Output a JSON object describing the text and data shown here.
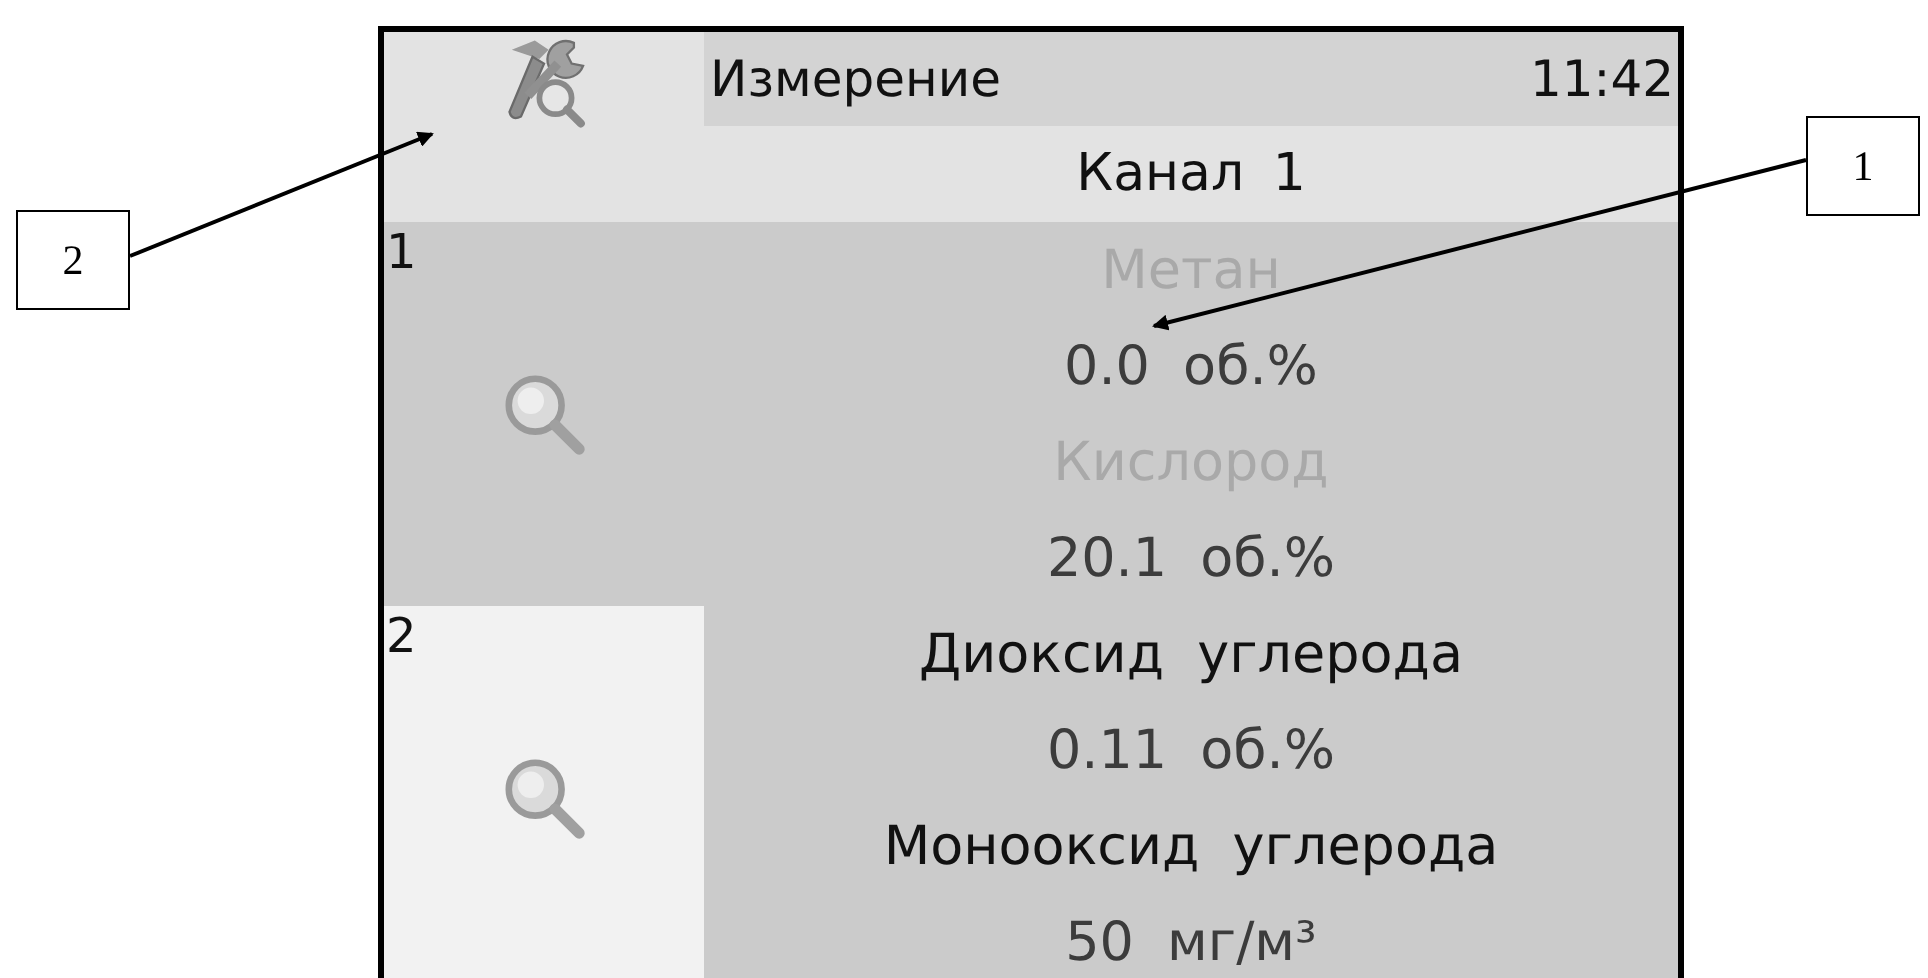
{
  "title": "Измерение",
  "time": "11:42",
  "channel": "Канал 1",
  "sensors": [
    {
      "number": "1",
      "selected": true,
      "gases": [
        {
          "name": "Метан",
          "value": "0.0 об.%",
          "active": false
        },
        {
          "name": "Кислород",
          "value": "20.1 об.%",
          "active": false
        }
      ]
    },
    {
      "number": "2",
      "selected": false,
      "gases": [
        {
          "name": "Диоксид углерода",
          "value": "0.11 об.%",
          "active": true
        },
        {
          "name": "Монооксид углерода",
          "value": "50 мг/м³",
          "active": true
        }
      ]
    }
  ],
  "callouts": [
    {
      "label": "2",
      "kind": "tools"
    },
    {
      "label": "1",
      "kind": "reading"
    }
  ]
}
